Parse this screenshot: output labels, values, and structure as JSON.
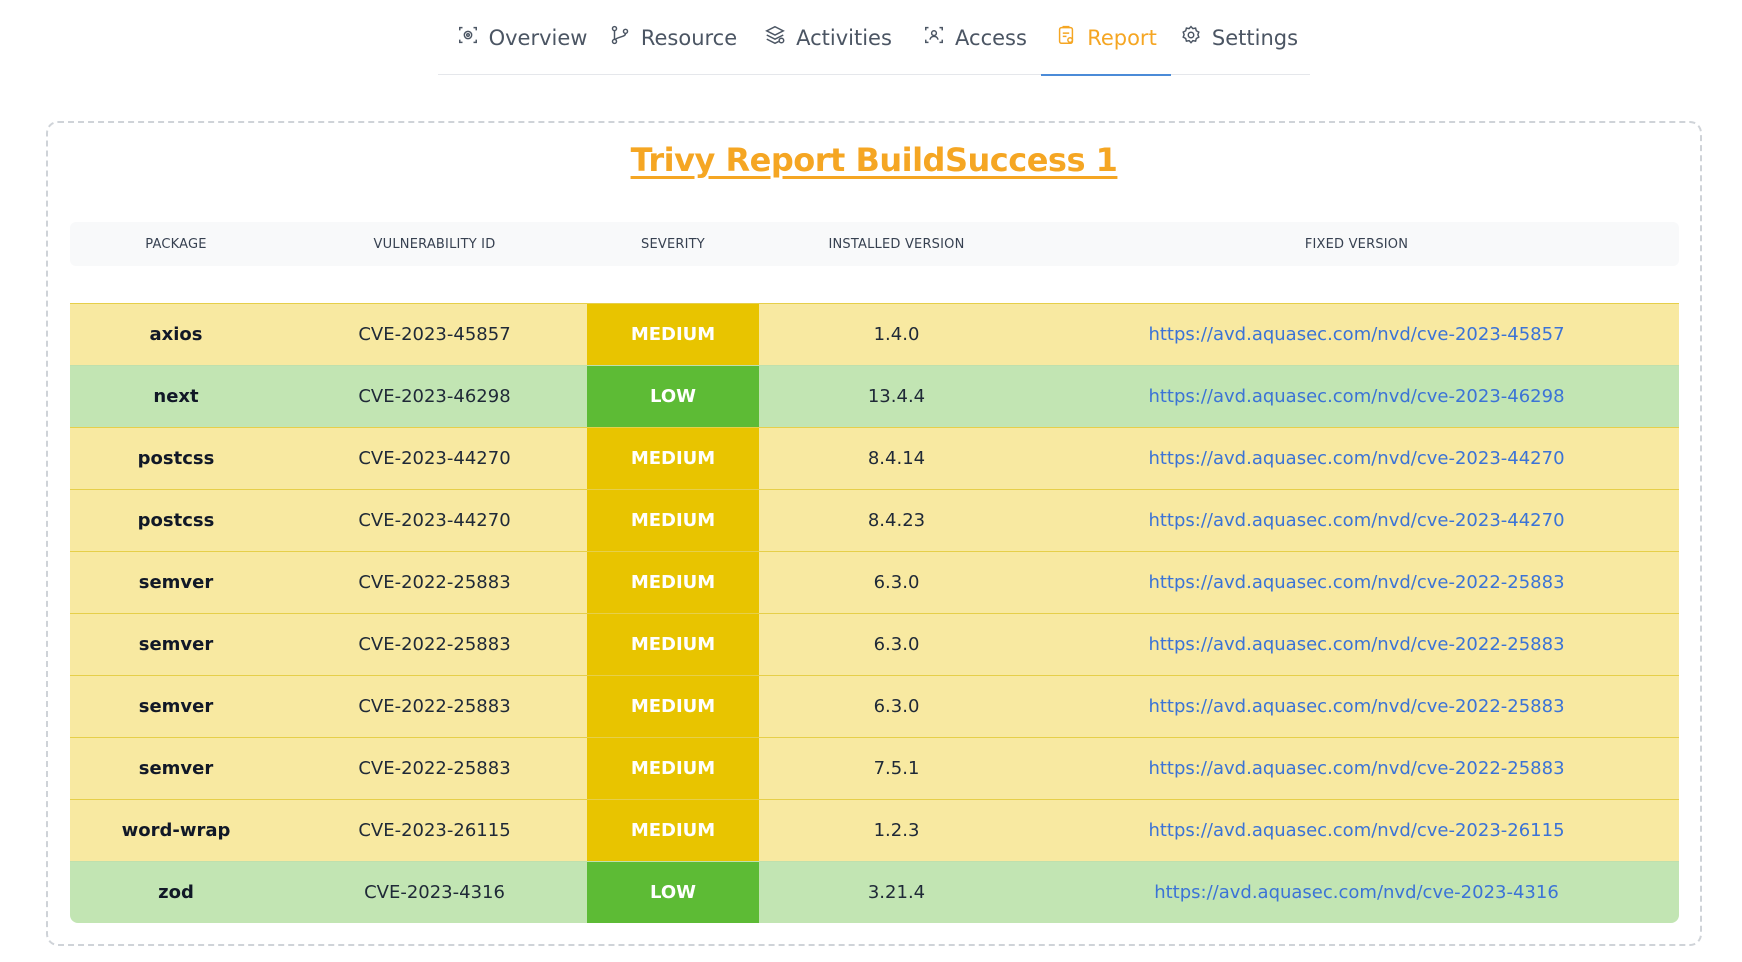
{
  "tabs": [
    {
      "label": "Overview",
      "icon": "overview-icon",
      "active": false
    },
    {
      "label": "Resource",
      "icon": "resource-icon",
      "active": false
    },
    {
      "label": "Activities",
      "icon": "activities-icon",
      "active": false
    },
    {
      "label": "Access",
      "icon": "access-icon",
      "active": false
    },
    {
      "label": "Report",
      "icon": "report-icon",
      "active": true
    },
    {
      "label": "Settings",
      "icon": "settings-icon",
      "active": false
    }
  ],
  "report": {
    "title": "Trivy Report BuildSuccess 1",
    "columns": [
      "PACKAGE",
      "VULNERABILITY ID",
      "SEVERITY",
      "INSTALLED VERSION",
      "FIXED VERSION"
    ],
    "rows": [
      {
        "package": "axios",
        "vulnerability_id": "CVE-2023-45857",
        "severity": "MEDIUM",
        "installed_version": "1.4.0",
        "fixed_version": "https://avd.aquasec.com/nvd/cve-2023-45857"
      },
      {
        "package": "next",
        "vulnerability_id": "CVE-2023-46298",
        "severity": "LOW",
        "installed_version": "13.4.4",
        "fixed_version": "https://avd.aquasec.com/nvd/cve-2023-46298"
      },
      {
        "package": "postcss",
        "vulnerability_id": "CVE-2023-44270",
        "severity": "MEDIUM",
        "installed_version": "8.4.14",
        "fixed_version": "https://avd.aquasec.com/nvd/cve-2023-44270"
      },
      {
        "package": "postcss",
        "vulnerability_id": "CVE-2023-44270",
        "severity": "MEDIUM",
        "installed_version": "8.4.23",
        "fixed_version": "https://avd.aquasec.com/nvd/cve-2023-44270"
      },
      {
        "package": "semver",
        "vulnerability_id": "CVE-2022-25883",
        "severity": "MEDIUM",
        "installed_version": "6.3.0",
        "fixed_version": "https://avd.aquasec.com/nvd/cve-2022-25883"
      },
      {
        "package": "semver",
        "vulnerability_id": "CVE-2022-25883",
        "severity": "MEDIUM",
        "installed_version": "6.3.0",
        "fixed_version": "https://avd.aquasec.com/nvd/cve-2022-25883"
      },
      {
        "package": "semver",
        "vulnerability_id": "CVE-2022-25883",
        "severity": "MEDIUM",
        "installed_version": "6.3.0",
        "fixed_version": "https://avd.aquasec.com/nvd/cve-2022-25883"
      },
      {
        "package": "semver",
        "vulnerability_id": "CVE-2022-25883",
        "severity": "MEDIUM",
        "installed_version": "7.5.1",
        "fixed_version": "https://avd.aquasec.com/nvd/cve-2022-25883"
      },
      {
        "package": "word-wrap",
        "vulnerability_id": "CVE-2023-26115",
        "severity": "MEDIUM",
        "installed_version": "1.2.3",
        "fixed_version": "https://avd.aquasec.com/nvd/cve-2023-26115"
      },
      {
        "package": "zod",
        "vulnerability_id": "CVE-2023-4316",
        "severity": "LOW",
        "installed_version": "3.21.4",
        "fixed_version": "https://avd.aquasec.com/nvd/cve-2023-4316"
      }
    ]
  },
  "colors": {
    "accent": "#f5a623",
    "tab_underline": "#4b8bd8",
    "medium_row": "#f8e9a1",
    "medium_badge": "#e8c400",
    "low_row": "#c2e5b3",
    "low_badge": "#5dbb35",
    "link": "#3b73d6"
  }
}
